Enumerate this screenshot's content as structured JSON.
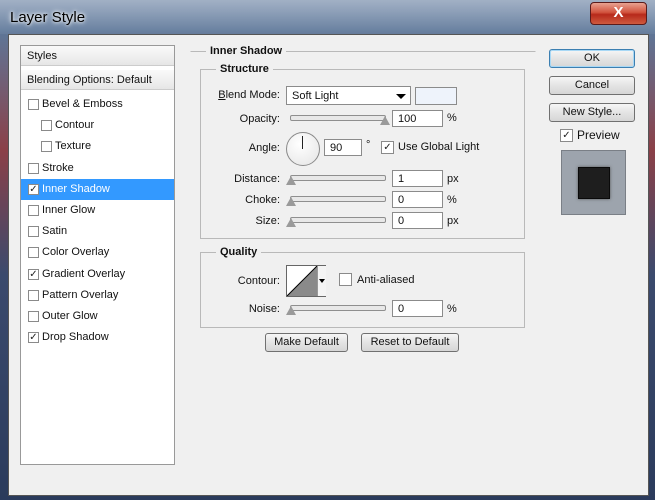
{
  "window": {
    "title": "Layer Style",
    "close": "X"
  },
  "styles_panel": {
    "header": "Styles",
    "blending": "Blending Options: Default",
    "items": [
      {
        "label": "Bevel & Emboss",
        "checked": false,
        "indent": 0
      },
      {
        "label": "Contour",
        "checked": false,
        "indent": 1
      },
      {
        "label": "Texture",
        "checked": false,
        "indent": 1
      },
      {
        "label": "Stroke",
        "checked": false,
        "indent": 0
      },
      {
        "label": "Inner Shadow",
        "checked": true,
        "indent": 0,
        "selected": true
      },
      {
        "label": "Inner Glow",
        "checked": false,
        "indent": 0
      },
      {
        "label": "Satin",
        "checked": false,
        "indent": 0
      },
      {
        "label": "Color Overlay",
        "checked": false,
        "indent": 0
      },
      {
        "label": "Gradient Overlay",
        "checked": true,
        "indent": 0
      },
      {
        "label": "Pattern Overlay",
        "checked": false,
        "indent": 0
      },
      {
        "label": "Outer Glow",
        "checked": false,
        "indent": 0
      },
      {
        "label": "Drop Shadow",
        "checked": true,
        "indent": 0
      }
    ]
  },
  "inner_shadow": {
    "title": "Inner Shadow",
    "structure": {
      "title": "Structure",
      "blend_mode_label": "Blend Mode:",
      "blend_mode": "Soft Light",
      "swatch_color": "#eef3fb",
      "opacity_label": "Opacity:",
      "opacity": "100",
      "opacity_unit": "%",
      "opacity_level": 1.0,
      "angle_label": "Angle:",
      "angle": "90",
      "angle_unit": "°",
      "global_light_label": "Use Global Light",
      "global_light": true,
      "distance_label": "Distance:",
      "distance": "1",
      "distance_unit": "px",
      "choke_label": "Choke:",
      "choke": "0",
      "choke_unit": "%",
      "size_label": "Size:",
      "size": "0",
      "size_unit": "px"
    },
    "quality": {
      "title": "Quality",
      "contour_label": "Contour:",
      "anti_aliased_label": "Anti-aliased",
      "anti_aliased": false,
      "noise_label": "Noise:",
      "noise": "0",
      "noise_unit": "%"
    },
    "make_default": "Make Default",
    "reset_default": "Reset to Default"
  },
  "actions": {
    "ok": "OK",
    "cancel": "Cancel",
    "new_style": "New Style...",
    "preview_label": "Preview",
    "preview": true
  }
}
